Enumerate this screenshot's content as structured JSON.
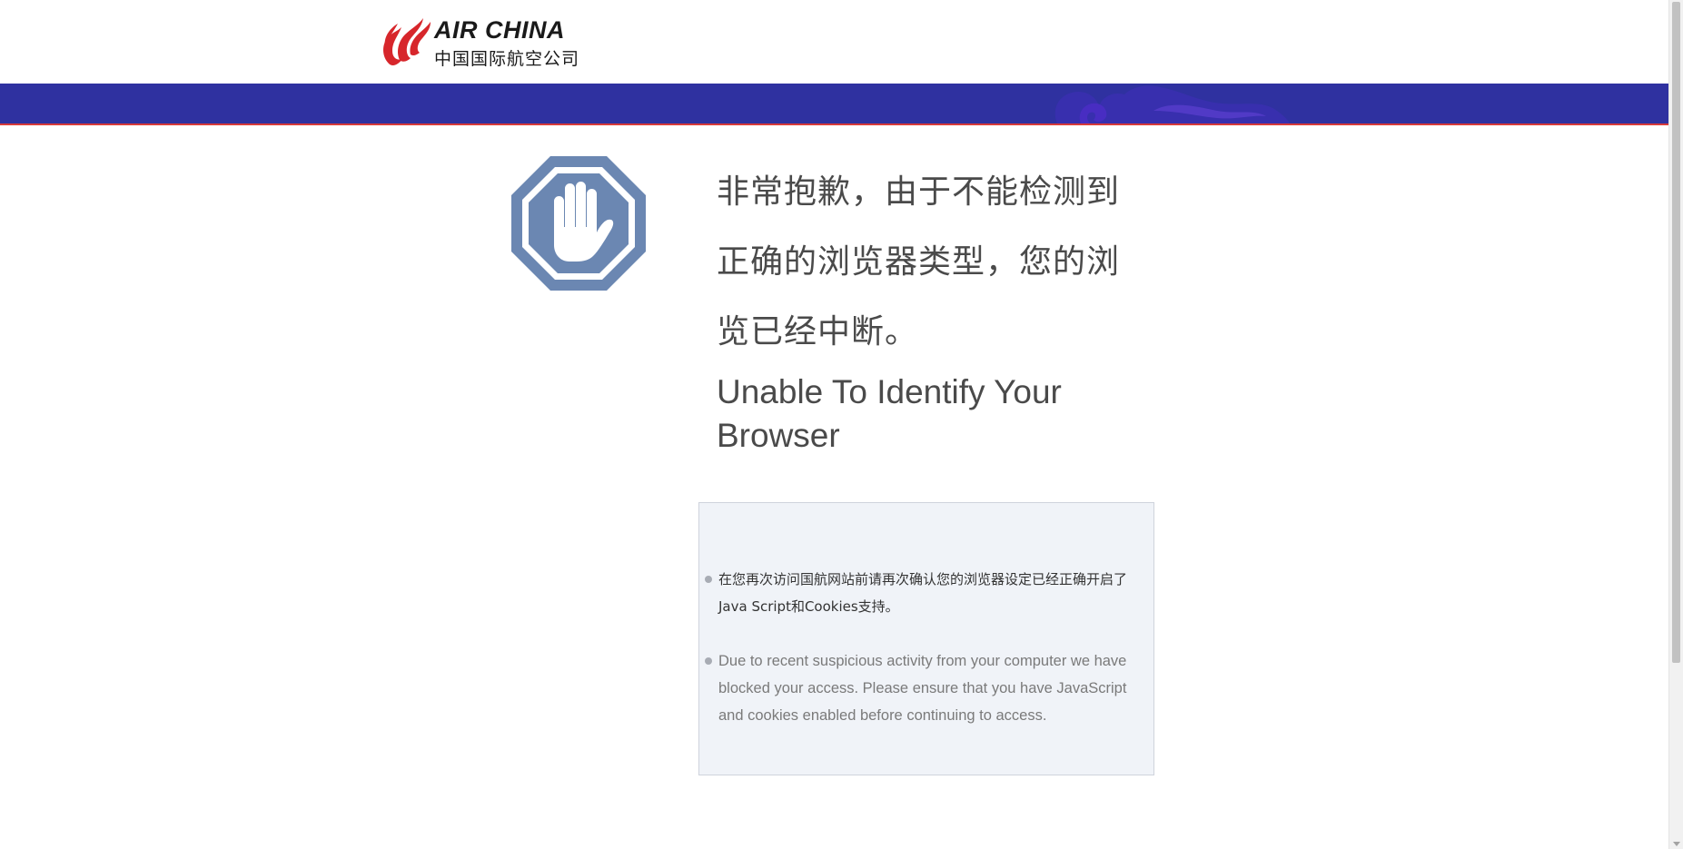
{
  "header": {
    "logo_text_en": "AIR CHINA",
    "logo_text_cn": "中国国际航空公司"
  },
  "colors": {
    "brand_blue": "#2f31a0",
    "brand_red": "#d7262b",
    "stop_icon": "#6b87b2",
    "info_box_bg": "#f0f3f8"
  },
  "icons": {
    "logo": "air-china-phoenix-logo",
    "stop": "stop-hand-icon",
    "bullet": "bullet-dot"
  },
  "main": {
    "heading_cn": "非常抱歉，由于不能检测到正确的浏览器类型，您的浏览已经中断。",
    "heading_en": "Unable To Identify Your Browser",
    "notices": [
      {
        "text": "在您再次访问国航网站前请再次确认您的浏览器设定已经正确开启了Java Script和Cookies支持。"
      },
      {
        "text": "Due to recent suspicious activity from your computer we have blocked your access. Please ensure that you have JavaScript and cookies enabled before continuing to access."
      }
    ]
  }
}
